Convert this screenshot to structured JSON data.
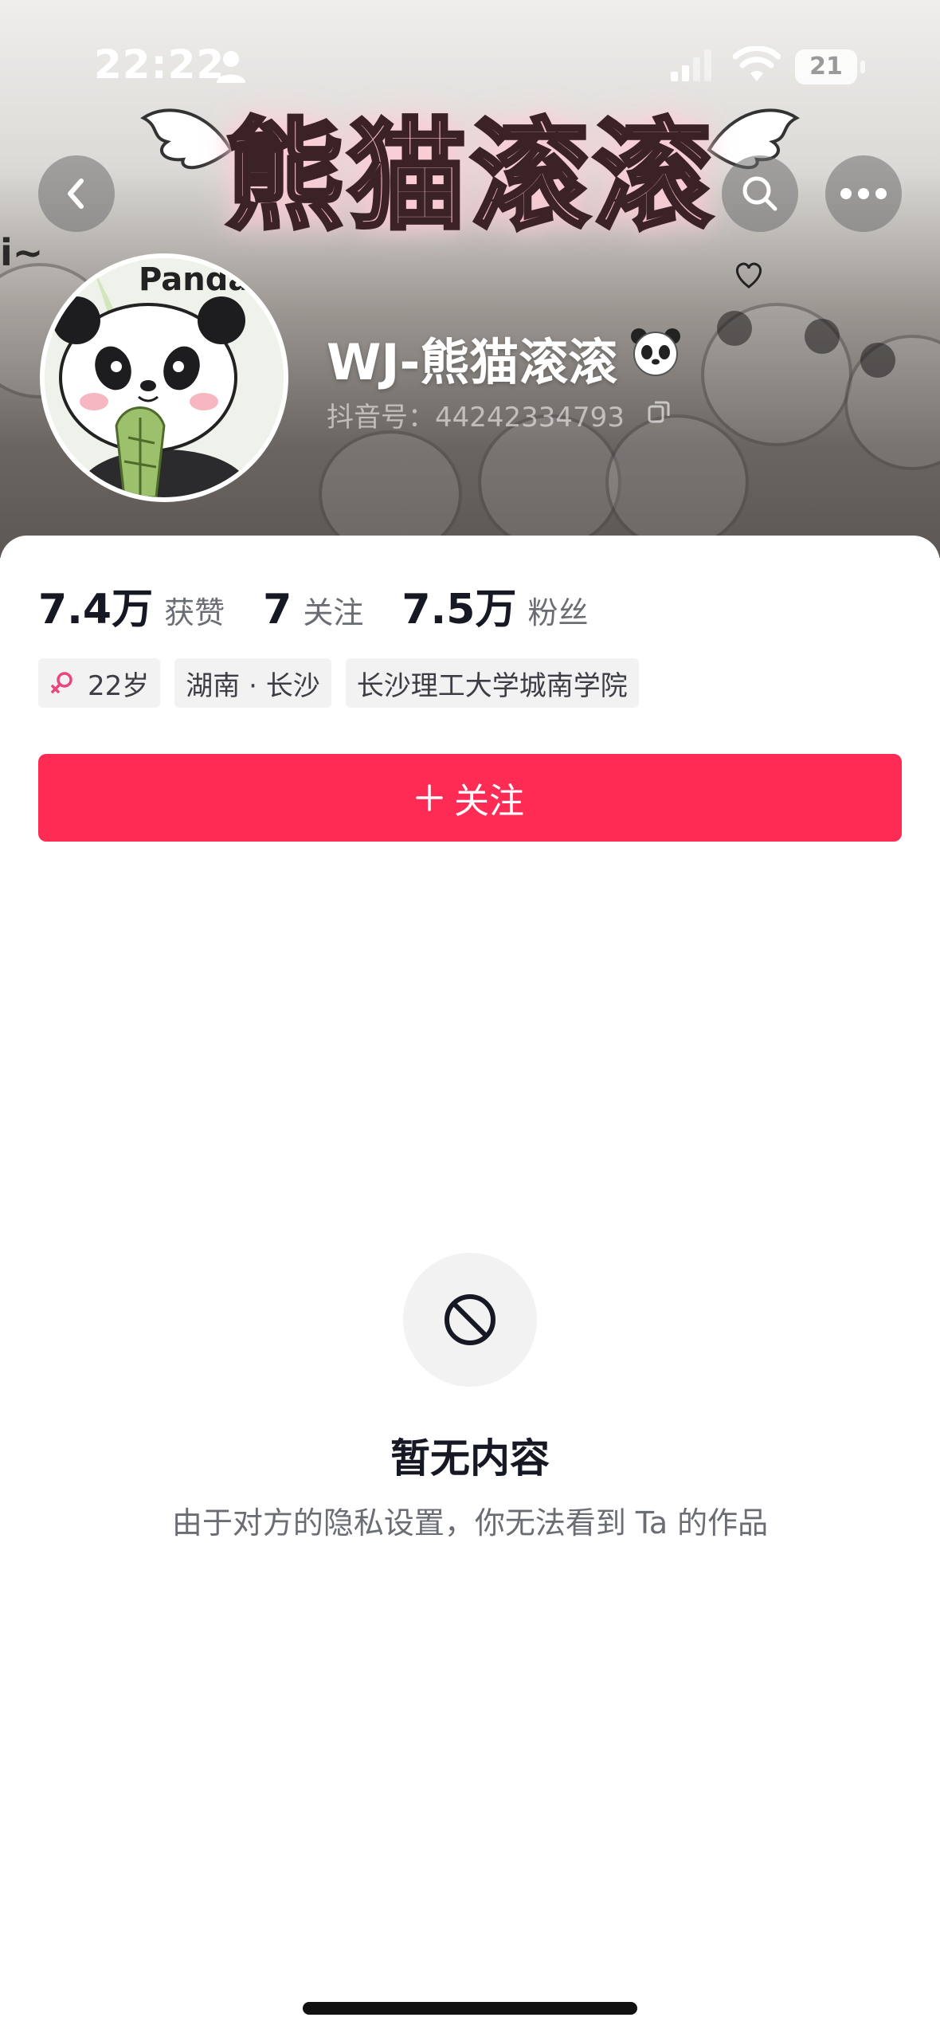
{
  "status_bar": {
    "time": "22:22",
    "battery": "21"
  },
  "banner": {
    "title": "熊猫滚滚",
    "sticker_text_1": "Panda",
    "sticker_text_2": "i~"
  },
  "profile": {
    "nickname": "WJ-熊猫滚滚",
    "douyin_id": "抖音号：44242334793"
  },
  "stats": [
    {
      "value": "7.4万",
      "label": "获赞"
    },
    {
      "value": "7",
      "label": "关注"
    },
    {
      "value": "7.5万",
      "label": "粉丝"
    }
  ],
  "tags": {
    "age": "22岁",
    "location": "湖南 · 长沙",
    "school": "长沙理工大学城南学院"
  },
  "follow_button": {
    "label": "关注"
  },
  "empty_state": {
    "title": "暂无内容",
    "description": "由于对方的隐私设置，你无法看到 Ta 的作品"
  },
  "colors": {
    "accent": "#fe2c55",
    "gender_icon": "#e9467d",
    "banner_title": "#f5b9c4"
  },
  "icons": {
    "back": "chevron-left-icon",
    "search": "search-icon",
    "more": "more-horizontal-icon",
    "copy": "copy-icon",
    "gender": "female-icon",
    "plus": "plus-icon",
    "empty": "prohibited-icon"
  }
}
